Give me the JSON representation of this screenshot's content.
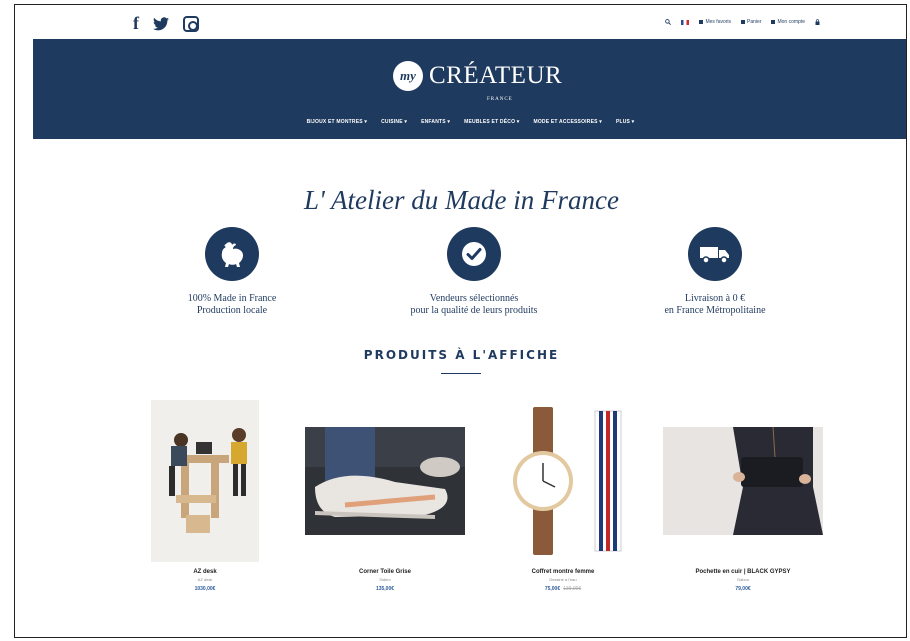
{
  "topbar": {
    "social": [
      "facebook-icon",
      "twitter-icon",
      "instagram-icon"
    ],
    "links": [
      {
        "icon": "search-icon",
        "label": "🔍"
      },
      {
        "icon": "flag-fr-icon",
        "label": ""
      },
      {
        "icon": "heart-icon",
        "label": "Mes favoris"
      },
      {
        "icon": "cart-icon",
        "label": "Panier"
      },
      {
        "icon": "user-icon",
        "label": "Mon compte"
      },
      {
        "icon": "lock-icon",
        "label": ""
      }
    ]
  },
  "header": {
    "logo_mark": "my",
    "logo_text": "CRÉATEUR",
    "logo_sub": "FRANCE",
    "nav": [
      "BIJOUX ET MONTRES ▾",
      "CUISINE ▾",
      "ENFANTS ▾",
      "MEUBLES ET DÉCO ▾",
      "MODE ET ACCESSOIRES ▾",
      "PLUS ▾"
    ]
  },
  "tagline": "L' Atelier du Made in France",
  "features": [
    {
      "icon": "rooster-icon",
      "line1": "100% Made in France",
      "line2": "Production locale"
    },
    {
      "icon": "check-icon",
      "line1": "Vendeurs sélectionnés",
      "line2": "pour la qualité de leurs produits"
    },
    {
      "icon": "truck-icon",
      "line1": "Livraison à 0 €",
      "line2": "en France Métropolitaine"
    }
  ],
  "section_title": "PRODUITS À L'AFFICHE",
  "products": [
    {
      "name": "AZ desk",
      "maker": "AZ desk",
      "price": "1030,00€",
      "old_price": ""
    },
    {
      "name": "Corner Toile Grise",
      "maker": "Sidero",
      "price": "135,00€",
      "old_price": ""
    },
    {
      "name": "Coffret montre femme",
      "maker": "Dessine à l'eau",
      "price": "75,00€",
      "old_price": "139,00€"
    },
    {
      "name": "Pochette en cuir | BLACK GYPSY",
      "maker": "Gabou",
      "price": "79,00€",
      "old_price": ""
    }
  ],
  "colors": {
    "primary": "#1f3a5f",
    "price": "#2e5a9b"
  }
}
